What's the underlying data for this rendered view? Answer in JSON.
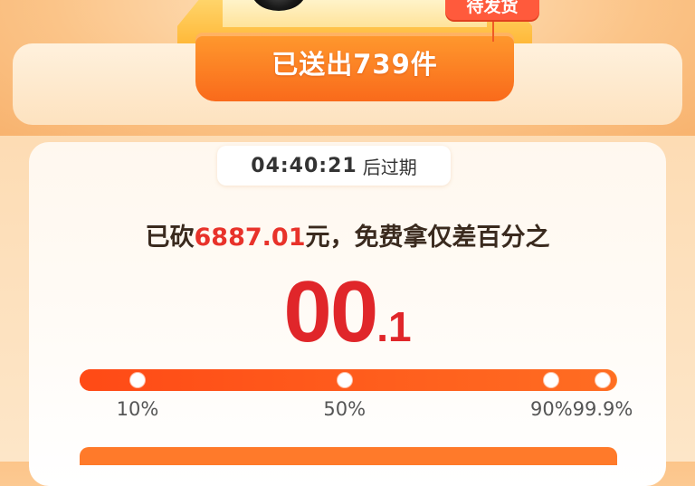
{
  "chest": {
    "status_badge": "待发货",
    "sent_text": "已送出739件"
  },
  "timer": {
    "time": "04:40:21",
    "suffix": "后过期"
  },
  "headline": {
    "prefix": "已砍",
    "amount": "6887.01",
    "suffix": "元，免费拿仅差百分之"
  },
  "remaining_percent": {
    "integer": "00",
    "decimal": ".1"
  },
  "progress": {
    "fraction": 0.999,
    "milestones": [
      {
        "label": "10%",
        "value": 10
      },
      {
        "label": "50%",
        "value": 50
      },
      {
        "label": "90%",
        "value": 90
      },
      {
        "label": "99.9%",
        "value": 99.9
      }
    ]
  },
  "colors": {
    "accent": "#e0262a",
    "bar": "#ff5a1e",
    "badge": "#ff5a3c"
  }
}
